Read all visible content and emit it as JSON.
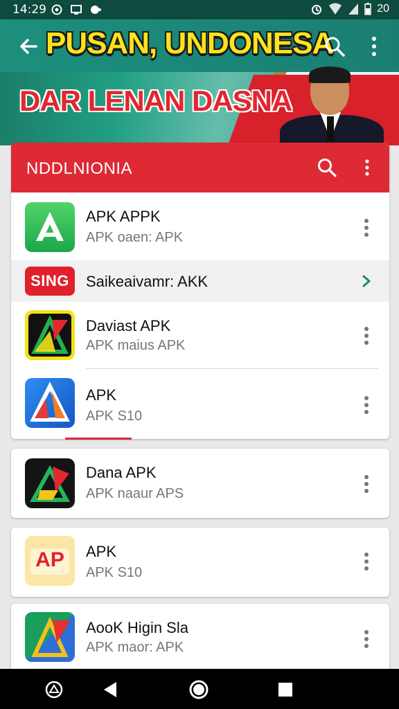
{
  "status_bar": {
    "time": "14:29",
    "right_text": "20"
  },
  "banner": {
    "title_line1": "PUSAN, UNDONESA",
    "title_line2": "DAR LENAN DASNA"
  },
  "list_card": {
    "title": "NDDLNIONIA"
  },
  "apps": [
    {
      "name": "APK APPK",
      "subtitle": "APK oaen: APK",
      "icon": "green-triangle-icon"
    },
    {
      "name": "Saikeaivamr: AKK",
      "badge": "SING",
      "icon": "sing-badge-icon"
    },
    {
      "name": "Daviast APK",
      "subtitle": "APK maius APK",
      "icon": "yellow-triangle-icon"
    },
    {
      "name": "APK",
      "subtitle": "APK S10",
      "icon": "blue-triangle-icon"
    }
  ],
  "extra_apps": [
    {
      "name": "Dana APK",
      "subtitle": "APK naaur APS",
      "icon": "dark-triangle-icon"
    },
    {
      "name": "APK",
      "subtitle": "APK S10",
      "badge": "AP",
      "icon": "ap-badge-icon"
    },
    {
      "name": "AooK Higin Sla",
      "subtitle": "APK maor: APK",
      "icon": "colorful-triangle-icon"
    }
  ],
  "colors": {
    "accent_red": "#dd2a35",
    "status_teal": "#0e4a3e",
    "arrow_green": "#1e8a5a"
  }
}
